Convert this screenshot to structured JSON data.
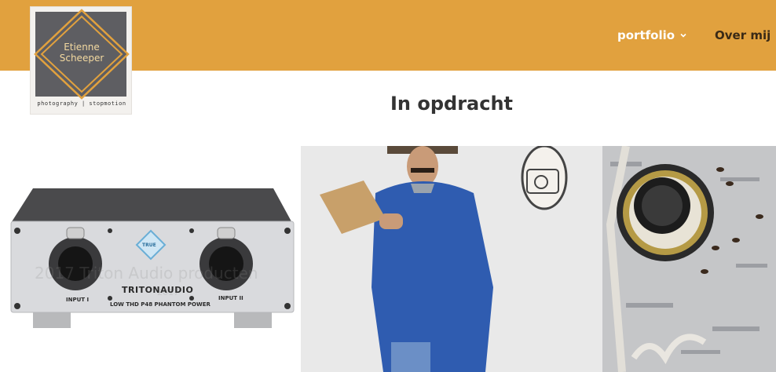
{
  "logo": {
    "name_line1": "Etienne",
    "name_line2": "Scheeper",
    "tagline": "photography | stopmotion"
  },
  "nav": {
    "items": [
      {
        "label": "portfolio",
        "has_dropdown": true
      },
      {
        "label": "Over mij",
        "has_dropdown": false
      }
    ]
  },
  "page": {
    "title": "In opdracht"
  },
  "portfolio": {
    "tiles": [
      {
        "caption": "2017 Triton Audio producten",
        "sub": "2017",
        "product_brand": "TRITONAUDIO",
        "panel_text": {
          "input1": "INPUT I",
          "input2": "INPUT II",
          "center": "LOW THD P48 PHANTOM POWER",
          "badge": "TRUE"
        }
      },
      {
        "caption": ""
      },
      {
        "caption": ""
      }
    ]
  },
  "colors": {
    "header_bg": "#e1a13e",
    "nav_active": "#ffffff",
    "nav_text": "#3a2a16",
    "title_text": "#333333"
  }
}
